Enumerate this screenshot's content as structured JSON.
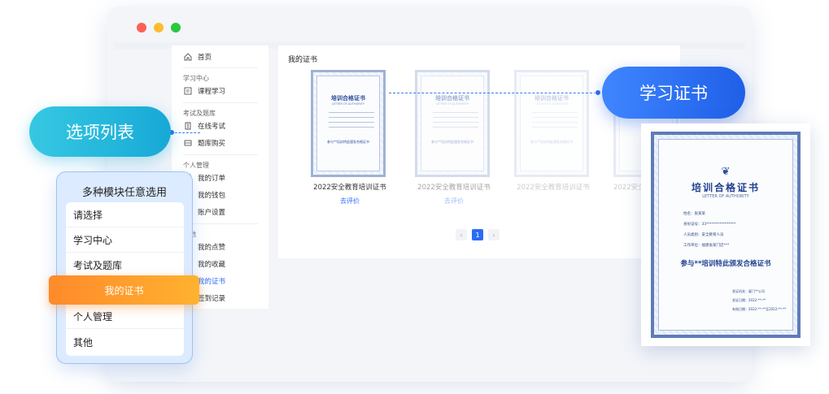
{
  "window": {
    "sidebar": {
      "items": [
        {
          "label": "首页",
          "icon": "home-icon"
        },
        {
          "section": "学习中心"
        },
        {
          "label": "课程学习",
          "icon": "book-icon"
        },
        {
          "section": "考试及题库"
        },
        {
          "label": "在线考试",
          "icon": "exam-icon"
        },
        {
          "label": "题库购买",
          "icon": "list-icon"
        },
        {
          "section": "个人管理"
        },
        {
          "label": "我的订单",
          "icon": "order-icon"
        },
        {
          "label": "我的钱包",
          "icon": "wallet-icon"
        },
        {
          "label": "账户设置",
          "icon": "settings-icon"
        },
        {
          "section": "其他"
        },
        {
          "label": "我的点赞",
          "icon": "like-icon"
        },
        {
          "label": "我的收藏",
          "icon": "heart-icon"
        },
        {
          "label": "我的证书",
          "icon": "certificate-icon",
          "active": true
        },
        {
          "label": "签到记录",
          "icon": "calendar-icon"
        }
      ]
    },
    "main": {
      "title": "我的证书",
      "certificates": [
        {
          "name": "2022安全教育培训证书",
          "action": "去评价"
        },
        {
          "name": "2022安全教育培训证书",
          "action": "去评价"
        },
        {
          "name": "2022安全教育培训证书",
          "action": ""
        },
        {
          "name": "2022安全",
          "action": ""
        }
      ],
      "thumb": {
        "head": "培训合格证书",
        "sub": "LETTER OF AUTHORITY",
        "foot": "参与**培训特此颁发合格证书"
      },
      "pager": {
        "prev": "‹",
        "current": "1",
        "next": "›"
      }
    }
  },
  "callouts": {
    "left": "选项列表",
    "right": "学习证书"
  },
  "popover": {
    "title": "多种模块任意选用",
    "options": [
      "请选择",
      "学习中心",
      "考试及题库",
      "我的证书",
      "个人管理",
      "其他"
    ],
    "selected": "我的证书"
  },
  "certificate": {
    "ornament": "❦",
    "title": "培训合格证书",
    "subtitle": "LETTER OF AUTHORITY",
    "fields": [
      "姓名：张某某",
      "身份证号：33****************",
      "人员类别：安全教育人员",
      "工作单位：福建省某门店***"
    ],
    "main_text": "参与**培训特此颁发合格证书",
    "sign": [
      "发证机关：厦门**公司",
      "发证日期：2022-**-**",
      "有效日期：2022-**-**至2022-**-**"
    ]
  },
  "colors": {
    "accent_blue": "#2b6cf6",
    "cyan": "#17a9d6",
    "orange": "#ff8a2b"
  }
}
